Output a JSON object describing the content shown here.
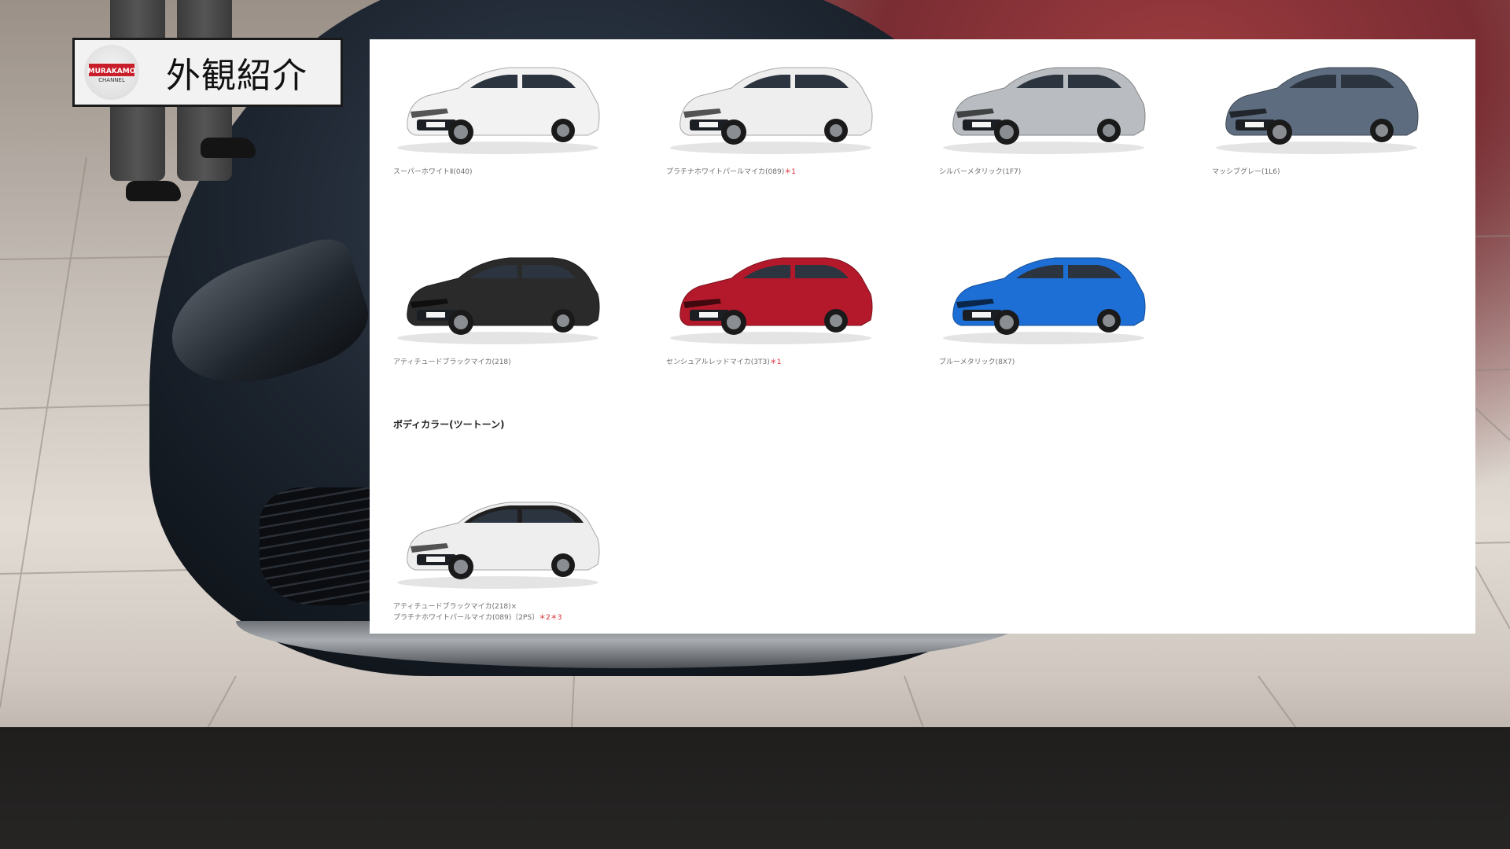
{
  "title_badge": {
    "logo_text": "MURAKAMO",
    "logo_sub": "CHANNEL",
    "title": "外観紹介"
  },
  "panel": {
    "solid_colors": [
      {
        "name": "スーパーホワイトⅡ(040)",
        "mark": "",
        "body_color": "#f2f2f2",
        "roof_color": "#f2f2f2"
      },
      {
        "name": "プラチナホワイトパールマイカ(089)",
        "mark": "＊1",
        "body_color": "#eeeeee",
        "roof_color": "#eeeeee"
      },
      {
        "name": "シルバーメタリック(1F7)",
        "mark": "",
        "body_color": "#b9bcc0",
        "roof_color": "#b9bcc0"
      },
      {
        "name": "マッシブグレー(1L6)",
        "mark": "",
        "body_color": "#5d6c7e",
        "roof_color": "#5d6c7e"
      },
      {
        "name": "アティチュードブラックマイカ(218)",
        "mark": "",
        "body_color": "#2a2a2b",
        "roof_color": "#2a2a2b"
      },
      {
        "name": "センシュアルレッドマイカ(3T3)",
        "mark": "＊1",
        "body_color": "#b3192a",
        "roof_color": "#b3192a"
      },
      {
        "name": "ブルーメタリック(8X7)",
        "mark": "",
        "body_color": "#1d6fd6",
        "roof_color": "#1d6fd6"
      }
    ],
    "two_tone_heading": "ボディカラー(ツートーン)",
    "two_tone_colors": [
      {
        "name_line1": "アティチュードブラックマイカ(218)×",
        "name_line2": "プラチナホワイトパールマイカ(089)〔2PS〕",
        "mark": "＊2＊3",
        "body_color": "#eeeeee",
        "roof_color": "#1f1f1f"
      }
    ]
  }
}
